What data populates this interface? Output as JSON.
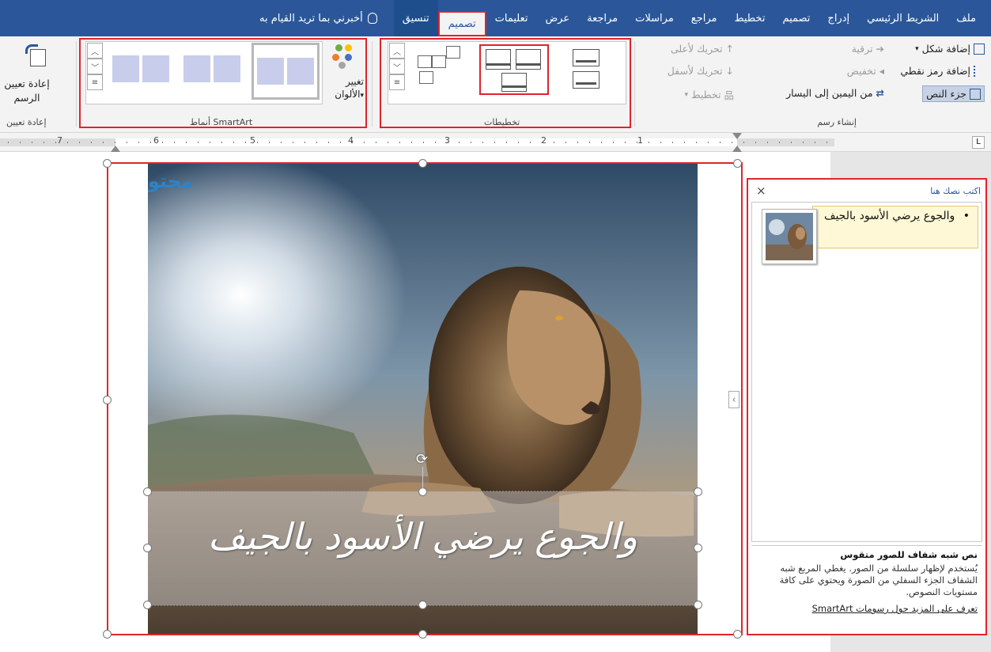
{
  "tabs": [
    {
      "label": "ملف",
      "state": ""
    },
    {
      "label": "الشريط الرئيسي",
      "state": ""
    },
    {
      "label": "إدراج",
      "state": ""
    },
    {
      "label": "تصميم",
      "state": ""
    },
    {
      "label": "تخطيط",
      "state": ""
    },
    {
      "label": "مراجع",
      "state": ""
    },
    {
      "label": "مراسلات",
      "state": ""
    },
    {
      "label": "مراجعة",
      "state": ""
    },
    {
      "label": "عرض",
      "state": ""
    },
    {
      "label": "تعليمات",
      "state": ""
    },
    {
      "label": "تصميم",
      "state": "selected"
    },
    {
      "label": "تنسيق",
      "state": "contextual"
    }
  ],
  "tell_me": "أخبرني بما تريد القيام به",
  "create_graphic": {
    "add_shape": "إضافة شكل",
    "add_bullet": "إضافة رمز نقطي",
    "text_pane": "جزء النص",
    "promote": "ترقية",
    "demote": "تخفيض",
    "right_to_left": "من اليمين إلى اليسار",
    "move_up": "تحريك لأعلى",
    "move_down": "تحريك لأسفل",
    "layout": "تخطيط",
    "group_label": "إنشاء رسم"
  },
  "layouts": {
    "group_label": "تخطيطات"
  },
  "smartart_styles": {
    "change_colors_1": "تغيير",
    "change_colors_2": "الألوان",
    "group_label": "أنماط SmartArt"
  },
  "reset": {
    "reset_graphic_1": "إعادة تعيين",
    "reset_graphic_2": "الرسم",
    "group_label": "إعادة تعيين"
  },
  "ruler": {
    "labels": [
      "1",
      "2",
      "3",
      "4",
      "5",
      "6",
      "7"
    ]
  },
  "canvas": {
    "watermark": "محتو",
    "caption": "والجوع يرضي الأسود بالجيف"
  },
  "text_pane": {
    "title": "اكتب نصك هنا",
    "close": "×",
    "bullet_text": "والجوع يرضي الأسود بالجيف",
    "desc_title": "نص شبه شفاف للصور متقوس",
    "desc_body": "يُستخدم لإظهار سلسلة من الصور. يغطي المربع شبه الشفاف الجزء السفلي من الصورة ويحتوي على كافة مستويات النصوص.",
    "learn_more": "تعرف على المزيد حول رسومات SmartArt"
  },
  "colors": {
    "tab_bar": "#2b579a",
    "highlight_box": "#e0242c",
    "ribbon": "#f3f3f3",
    "style_fill": "#c8cdeb"
  }
}
